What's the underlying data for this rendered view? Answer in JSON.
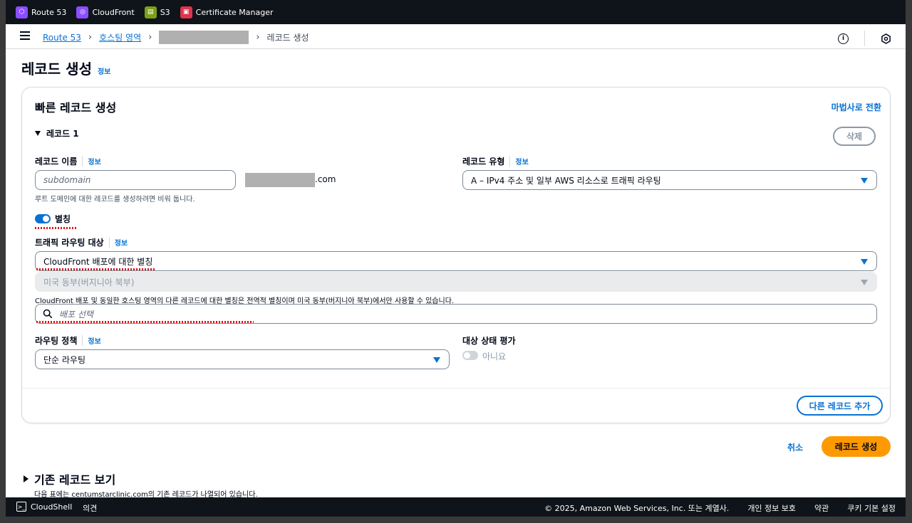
{
  "favorites": [
    {
      "label": "Route 53",
      "icon": "route53-icon",
      "color": "#8c4fff"
    },
    {
      "label": "CloudFront",
      "icon": "cloudfront-icon",
      "color": "#8c4fff"
    },
    {
      "label": "S3",
      "icon": "s3-icon",
      "color": "#7aa116"
    },
    {
      "label": "Certificate Manager",
      "icon": "certificate-manager-icon",
      "color": "#dd344c"
    }
  ],
  "breadcrumb": {
    "items": [
      "Route 53",
      "호스팅 영역"
    ],
    "current": "레코드 생성"
  },
  "page": {
    "title": "레코드 생성",
    "info": "정보"
  },
  "quick": {
    "title": "빠른 레코드 생성",
    "wizard_link": "마법사로 전환",
    "record_header": "레코드 1",
    "delete_button": "삭제",
    "record_name": {
      "label": "레코드 이름",
      "info": "정보",
      "placeholder": "subdomain",
      "domain_suffix": ".com",
      "hint": "루트 도메인에 대한 레코드를 생성하려면 비워 둡니다."
    },
    "record_type": {
      "label": "레코드 유형",
      "info": "정보",
      "value": "A – IPv4 주소 및 일부 AWS 리소스로 트래픽 라우팅"
    },
    "alias": {
      "label": "별칭",
      "enabled": true
    },
    "traffic_target": {
      "label": "트래픽 라우팅 대상",
      "info": "정보",
      "value": "CloudFront 배포에 대한 별칭",
      "region": "미국 동부(버지니아 북부)",
      "hint": "CloudFront 배포 및 동일한 호스팅 영역의 다른 레코드에 대한 별칭은 전역적 별칭이며 미국 동부(버지니아 북부)에서만 사용할 수 있습니다.",
      "search_placeholder": "배포 선택"
    },
    "routing_policy": {
      "label": "라우팅 정책",
      "info": "정보",
      "value": "단순 라우팅"
    },
    "health": {
      "label": "대상 상태 평가",
      "value": "아니요",
      "enabled": false
    },
    "add_record_button": "다른 레코드 추가"
  },
  "actions": {
    "cancel": "취소",
    "create": "레코드 생성"
  },
  "existing": {
    "title": "기존 레코드 보기",
    "desc": "다음 표에는 centumstarclinic.com의 기존 레코드가 나열되어 있습니다."
  },
  "footer": {
    "cloudshell": "CloudShell",
    "feedback": "의견",
    "copyright": "© 2025, Amazon Web Services, Inc. 또는 계열사.",
    "privacy": "개인 정보 보호",
    "terms": "약관",
    "cookies": "쿠키 기본 설정"
  },
  "colors": {
    "link": "#0972d3",
    "primary_button": "#ff9900",
    "toggle_on": "#0972d3",
    "toggle_off": "#d1d5db"
  }
}
